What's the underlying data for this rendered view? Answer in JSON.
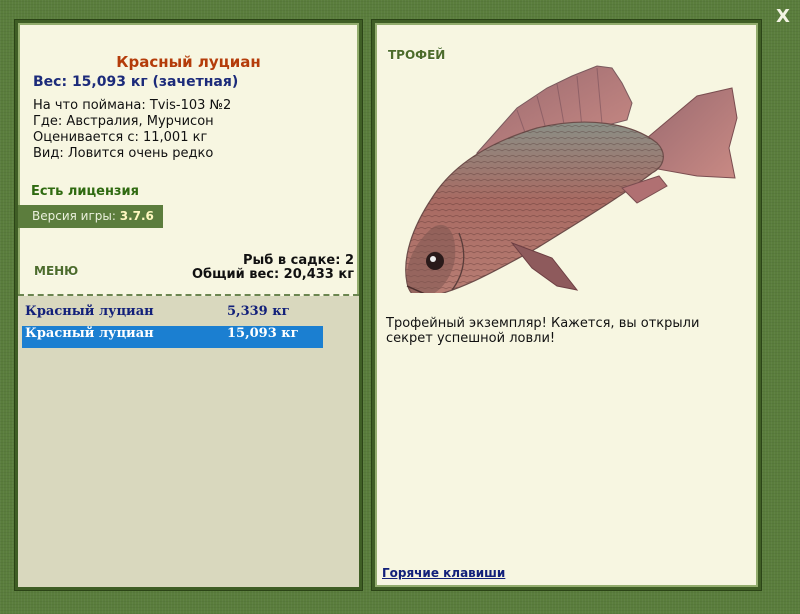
{
  "close_label": "X",
  "fish": {
    "title": "Красный луциан",
    "weight_line": "Вес: 15,093 кг (зачетная)",
    "caught_with": "На что поймана: Tvis-103 №2",
    "location": "Где: Австралия, Мурчисон",
    "valued_from": "Оценивается с: 11,001 кг",
    "rarity": "Вид: Ловится очень редко"
  },
  "license": "Есть лицензия",
  "version": {
    "label": "Версия игры:",
    "value": "3.7.6"
  },
  "menu_label": "МЕНЮ",
  "cage": {
    "count_line": "Рыб в садке: 2",
    "total_line": "Общий вес: 20,433 кг"
  },
  "catch_list": [
    {
      "name": "Красный луциан",
      "weight": "5,339 кг",
      "selected": false
    },
    {
      "name": "Красный луциан",
      "weight": "15,093 кг",
      "selected": true
    }
  ],
  "trophy": {
    "label": "ТРОФЕЙ",
    "description": "Трофейный экземпляр! Кажется, вы открыли секрет успешной ловли!"
  },
  "hotkeys_label": "Горячие клавиши",
  "colors": {
    "background": "#5a7d3c",
    "panel": "#f7f6e1",
    "title": "#b43c0a",
    "accent_blue": "#12207a",
    "selection": "#1b7fd1"
  }
}
